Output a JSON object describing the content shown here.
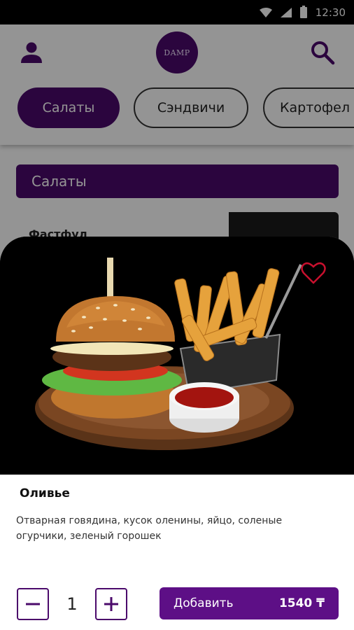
{
  "status_bar": {
    "time": "12:30"
  },
  "header": {
    "logo_text": "DAMP",
    "tabs": [
      {
        "label": "Салаты",
        "active": true
      },
      {
        "label": "Сэндвичи",
        "active": false
      },
      {
        "label": "Картофел",
        "active": false
      }
    ]
  },
  "list": {
    "section_title": "Салаты",
    "card_title": "Фастфуд"
  },
  "sheet": {
    "product_name": "Оливье",
    "description": "Отварная говядина, кусок оленины, яйцо, соленые огурчики, зеленый горошек",
    "quantity": "1",
    "add_label": "Добавить",
    "price": "1540 ₸"
  },
  "colors": {
    "brand": "#4b0a6b",
    "button": "#5d0f86",
    "favorite": "#c8102e"
  },
  "icons": [
    "wifi-icon",
    "signal-icon",
    "battery-icon",
    "user-icon",
    "search-icon",
    "heart-icon",
    "minus-icon",
    "plus-icon"
  ]
}
